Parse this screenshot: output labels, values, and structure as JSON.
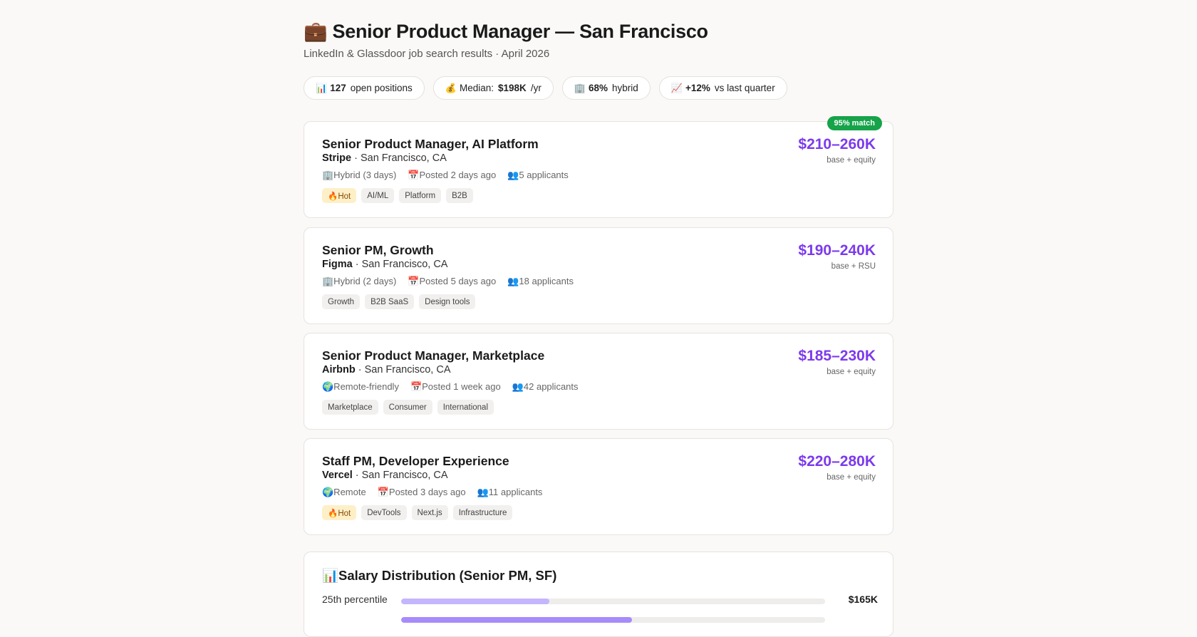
{
  "header": {
    "icon": "briefcase-icon",
    "title": "💼 Senior Product Manager — San Francisco",
    "subtitle": "LinkedIn & Glassdoor job search results · April 2026"
  },
  "stats": [
    {
      "icon": "📊",
      "value": "127",
      "pre": "",
      "label": "open positions"
    },
    {
      "icon": "💰",
      "value": "$198K",
      "pre": "Median:",
      "label": "/yr"
    },
    {
      "icon": "🏢",
      "value": "68%",
      "pre": "",
      "label": "hybrid"
    },
    {
      "icon": "📈",
      "value": "+12%",
      "pre": "",
      "label": "vs last quarter"
    }
  ],
  "jobs": [
    {
      "title": "Senior Product Manager, AI Platform",
      "company": "Stripe",
      "location": "· San Francisco, CA",
      "work_mode": "🏢Hybrid (3 days)",
      "posted": "📅Posted 2 days ago",
      "applicants": "👥5 applicants",
      "tags": [
        "🔥Hot",
        "AI/ML",
        "Platform",
        "B2B"
      ],
      "hot": true,
      "salary": "$210–260K",
      "salary_note": "base + equity",
      "match": "95% match"
    },
    {
      "title": "Senior PM, Growth",
      "company": "Figma",
      "location": "· San Francisco, CA",
      "work_mode": "🏢Hybrid (2 days)",
      "posted": "📅Posted 5 days ago",
      "applicants": "👥18 applicants",
      "tags": [
        "Growth",
        "B2B SaaS",
        "Design tools"
      ],
      "hot": false,
      "salary": "$190–240K",
      "salary_note": "base + RSU",
      "match": ""
    },
    {
      "title": "Senior Product Manager, Marketplace",
      "company": "Airbnb",
      "location": "· San Francisco, CA",
      "work_mode": "🌍Remote-friendly",
      "posted": "📅Posted 1 week ago",
      "applicants": "👥42 applicants",
      "tags": [
        "Marketplace",
        "Consumer",
        "International"
      ],
      "hot": false,
      "salary": "$185–230K",
      "salary_note": "base + equity",
      "match": ""
    },
    {
      "title": "Staff PM, Developer Experience",
      "company": "Vercel",
      "location": "· San Francisco, CA",
      "work_mode": "🌍Remote",
      "posted": "📅Posted 3 days ago",
      "applicants": "👥11 applicants",
      "tags": [
        "🔥Hot",
        "DevTools",
        "Next.js",
        "Infrastructure"
      ],
      "hot": true,
      "salary": "$220–280K",
      "salary_note": "base + equity",
      "match": ""
    }
  ],
  "distribution": {
    "title": "📊Salary Distribution (Senior PM, SF)",
    "rows": [
      {
        "label": "25th percentile",
        "value": "$165K",
        "fraction": 0.35,
        "color": "#c4b5fd"
      },
      {
        "label": "",
        "value": "",
        "fraction": 0.545,
        "color": "#a78bfa"
      }
    ]
  },
  "colors": {
    "accent": "#7c3aed",
    "match_badge": "#16a34a",
    "hot_tag": "#fdf0c8"
  }
}
